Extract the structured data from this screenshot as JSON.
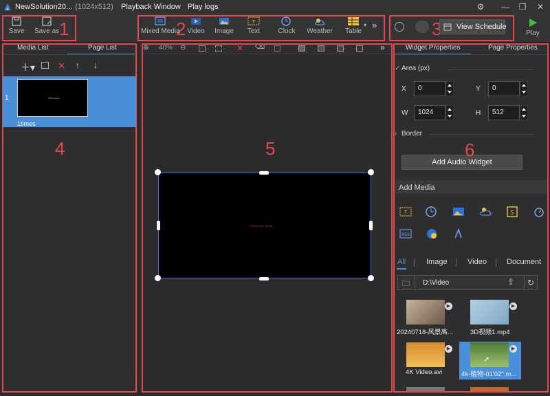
{
  "titlebar": {
    "app_title": "NewSolution20...",
    "resolution": "(1024x512)",
    "menu": [
      "Playback Window",
      "Play logs"
    ]
  },
  "toolbar": {
    "save": "Save",
    "save_as": "Save as",
    "widgets": [
      "Mixed Media",
      "Video",
      "Image",
      "Text",
      "Clock",
      "Weather",
      "Table"
    ],
    "view_schedule": "View Schedule",
    "play": "Play"
  },
  "left_panel": {
    "tabs": [
      "Media List",
      "Page List"
    ],
    "active_tab": "Page List",
    "page_index": "1",
    "page_duration": "1times",
    "thumb_text": "Welcome"
  },
  "center": {
    "zoom": "40%",
    "canvas_text": "Create your media"
  },
  "right_panel": {
    "tabs": [
      "Widget Properties",
      "Page Properties"
    ],
    "active_tab": "Widget Properties",
    "area_label": "Area (px)",
    "x_label": "X",
    "x_value": "0",
    "y_label": "Y",
    "y_value": "0",
    "w_label": "W",
    "w_value": "1024",
    "h_label": "H",
    "h_value": "512",
    "border_label": "Border",
    "add_audio": "Add Audio Widget",
    "add_media": "Add Media",
    "categories": [
      "All",
      "Image",
      "Video",
      "Document"
    ],
    "active_category": "All",
    "path": "D:\\Video",
    "media_files": [
      "20240718-风景高...",
      "3D视频1.mp4",
      "4K Video.avi",
      "4k-植物-01'02\".m..."
    ]
  },
  "annotations": [
    "1",
    "2",
    "3",
    "4",
    "5",
    "6"
  ],
  "colors": {
    "accent": "#4a90d9",
    "annotation": "#e5484d",
    "play": "#3fbf3f"
  }
}
